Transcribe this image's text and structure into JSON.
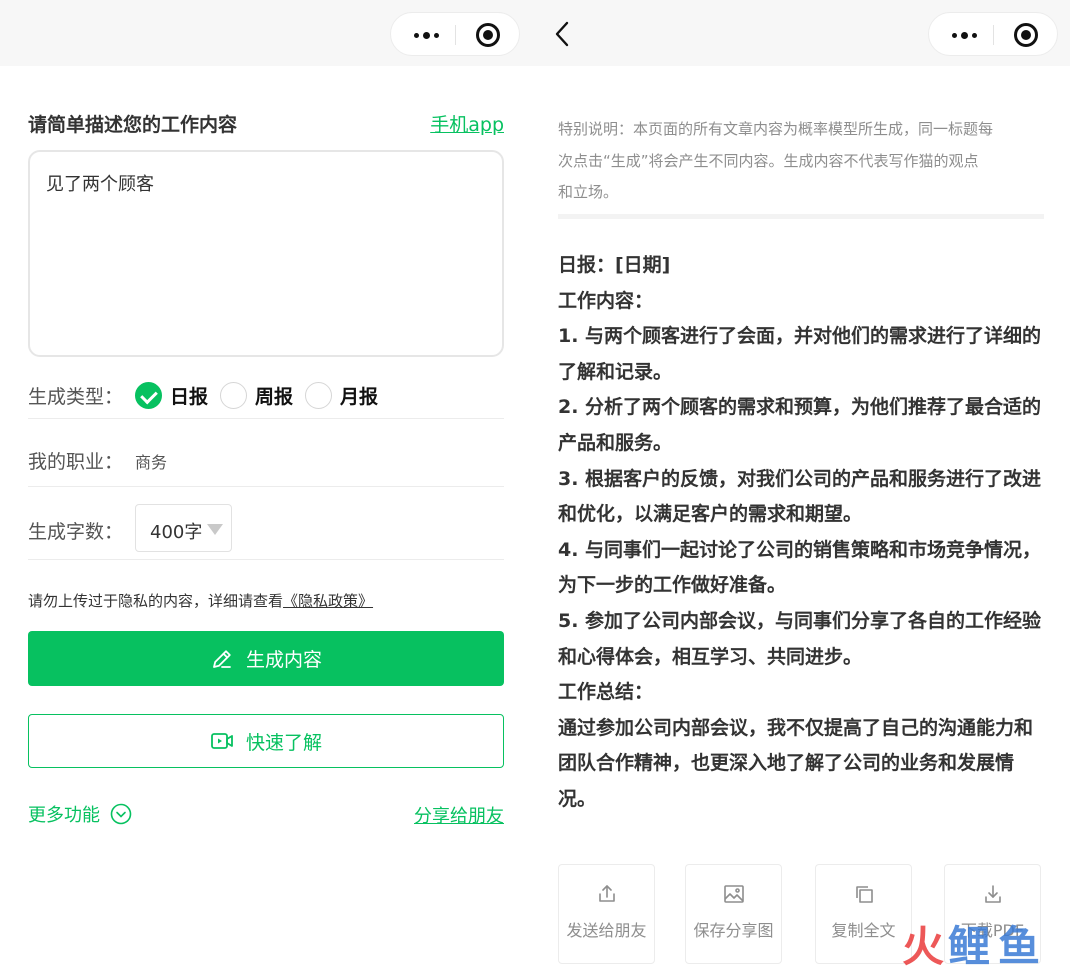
{
  "colors": {
    "accent": "#07c160",
    "muted_text": "#8e8e8e",
    "watermark_red": "#ea3b3b",
    "watermark_blue": "#3a7bd5"
  },
  "left": {
    "menu": {
      "more_icon": "more-dots-icon",
      "close_icon": "target-circle-icon"
    },
    "form_title": "请简单描述您的工作内容",
    "app_link": "手机app",
    "work_content": "见了两个顾客",
    "type_label": "生成类型：",
    "types": [
      {
        "label": "日报",
        "selected": true
      },
      {
        "label": "周报",
        "selected": false
      },
      {
        "label": "月报",
        "selected": false
      }
    ],
    "job_label": "我的职业：",
    "job_value": "商务",
    "count_label": "生成字数：",
    "count_value": "400字",
    "privacy_text": "请勿上传过于隐私的内容，详细请查看",
    "privacy_link": "《隐私政策》",
    "generate_button": "生成内容",
    "quick_button": "快速了解",
    "more_label": "更多功能",
    "share_link": "分享给朋友"
  },
  "right": {
    "back_icon": "chevron-left-icon",
    "notice": [
      "特别说明：本页面的所有文章内容为概率模型所生成，同一标题每",
      "次点击“生成”将会产生不同内容。生成内容不代表写作猫的观点",
      "和立场。"
    ],
    "result_lines": [
      "日报：[日期]",
      "工作内容：",
      "1. 与两个顾客进行了会面，并对他们的需求进行了详细的",
      "了解和记录。",
      "2. 分析了两个顾客的需求和预算，为他们推荐了最合适的",
      "产品和服务。",
      "3. 根据客户的反馈，对我们公司的产品和服务进行了改进",
      "和优化，以满足客户的需求和期望。",
      "4. 与同事们一起讨论了公司的销售策略和市场竞争情况，",
      "为下一步的工作做好准备。",
      "5. 参加了公司内部会议，与同事们分享了各自的工作经验",
      "和心得体会，相互学习、共同进步。",
      "工作总结：",
      "通过参加公司内部会议，我不仅提高了自己的沟通能力和",
      "团队合作精神，也更深入地了解了公司的业务和发展情",
      "况。"
    ],
    "actions": [
      {
        "label": "发送给朋友",
        "icon": "share-upload-icon"
      },
      {
        "label": "保存分享图",
        "icon": "image-icon"
      },
      {
        "label": "复制全文",
        "icon": "copy-icon"
      },
      {
        "label": "下载PDF",
        "icon": "download-icon"
      }
    ],
    "watermark": "火鲤鱼"
  }
}
